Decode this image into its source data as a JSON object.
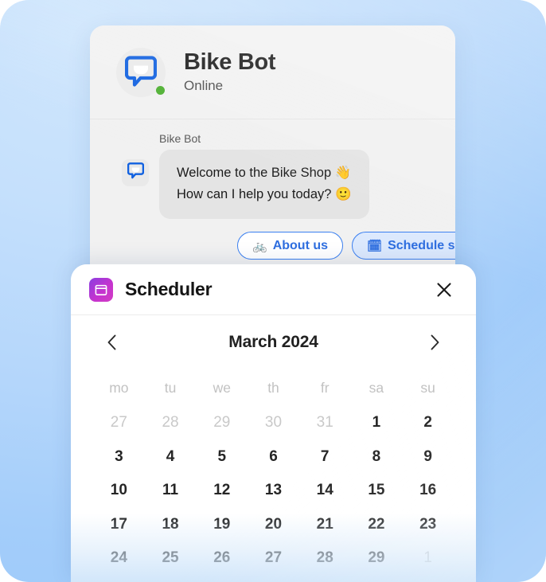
{
  "theme": {
    "background_blue": "#a8cffa",
    "accent_blue": "#2f6fe0",
    "online_green": "#4caf2f",
    "scheduler_purple": "#c433cf"
  },
  "chat": {
    "header": {
      "bot_name": "Bike Bot",
      "status": "Online",
      "avatar_icon": "chat-bubble-face-icon",
      "online_indicator": "online-dot"
    },
    "message": {
      "sender": "Bike Bot",
      "avatar_icon": "chat-bubble-face-icon",
      "lines": [
        "Welcome to the Bike Shop 👋",
        "How can I help you today?  🙂"
      ]
    },
    "quick_replies": [
      {
        "emoji": "🚲",
        "label": "About us",
        "selected": false
      },
      {
        "emoji": "🗓",
        "label": "Schedule service",
        "selected": true
      }
    ]
  },
  "scheduler": {
    "icon": "calendar-icon",
    "title": "Scheduler",
    "close_label": "✕",
    "calendar": {
      "prev_label": "‹",
      "next_label": "›",
      "month_label": "March 2024",
      "weekdays": [
        "mo",
        "tu",
        "we",
        "th",
        "fr",
        "sa",
        "su"
      ],
      "weeks": [
        [
          {
            "n": "27",
            "muted": true
          },
          {
            "n": "28",
            "muted": true
          },
          {
            "n": "29",
            "muted": true
          },
          {
            "n": "30",
            "muted": true
          },
          {
            "n": "31",
            "muted": true
          },
          {
            "n": "1",
            "muted": false
          },
          {
            "n": "2",
            "muted": false
          }
        ],
        [
          {
            "n": "3",
            "muted": false
          },
          {
            "n": "4",
            "muted": false
          },
          {
            "n": "5",
            "muted": false
          },
          {
            "n": "6",
            "muted": false
          },
          {
            "n": "7",
            "muted": false
          },
          {
            "n": "8",
            "muted": false
          },
          {
            "n": "9",
            "muted": false
          }
        ],
        [
          {
            "n": "10",
            "muted": false
          },
          {
            "n": "11",
            "muted": false
          },
          {
            "n": "12",
            "muted": false
          },
          {
            "n": "13",
            "muted": false
          },
          {
            "n": "14",
            "muted": false
          },
          {
            "n": "15",
            "muted": false
          },
          {
            "n": "16",
            "muted": false
          }
        ],
        [
          {
            "n": "17",
            "muted": false
          },
          {
            "n": "18",
            "muted": false
          },
          {
            "n": "19",
            "muted": false
          },
          {
            "n": "20",
            "muted": false
          },
          {
            "n": "21",
            "muted": false
          },
          {
            "n": "22",
            "muted": false
          },
          {
            "n": "23",
            "muted": false
          }
        ],
        [
          {
            "n": "24",
            "muted": false
          },
          {
            "n": "25",
            "muted": false
          },
          {
            "n": "26",
            "muted": false
          },
          {
            "n": "27",
            "muted": false
          },
          {
            "n": "28",
            "muted": false
          },
          {
            "n": "29",
            "muted": false
          },
          {
            "n": "1",
            "muted": true
          }
        ]
      ]
    }
  }
}
